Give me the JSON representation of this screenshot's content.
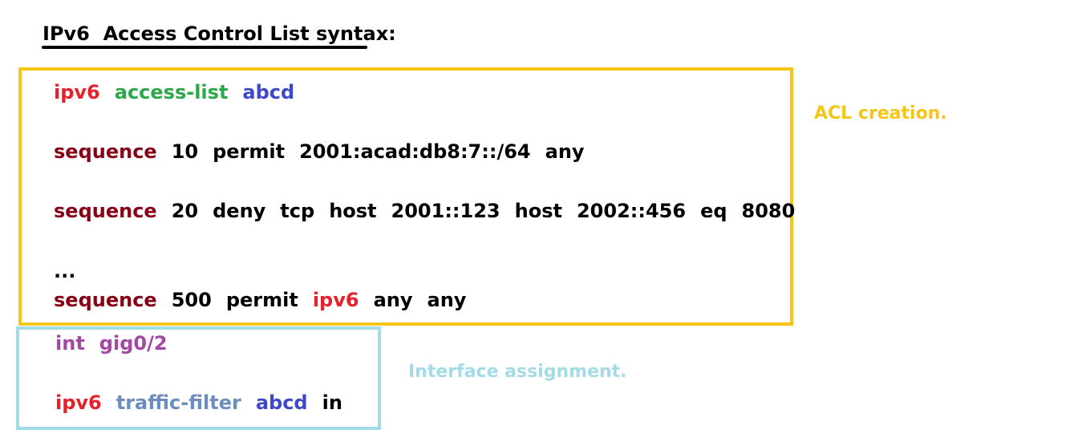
{
  "title": "IPv6  Access Control List syntax:",
  "acl_section": {
    "label": "ACL creation.",
    "lines": [
      [
        {
          "text": "ipv6",
          "color": "red"
        },
        {
          "text": "access-list",
          "color": "green"
        },
        {
          "text": "abcd",
          "color": "blue"
        }
      ],
      [
        {
          "text": "sequence",
          "color": "maroon"
        },
        {
          "text": "10",
          "color": "black"
        },
        {
          "text": "permit",
          "color": "black"
        },
        {
          "text": "2001:acad:db8:7::/64",
          "color": "black"
        },
        {
          "text": "any",
          "color": "black"
        }
      ],
      [
        {
          "text": "sequence",
          "color": "maroon"
        },
        {
          "text": "20",
          "color": "black"
        },
        {
          "text": "deny",
          "color": "black"
        },
        {
          "text": "tcp",
          "color": "black"
        },
        {
          "text": "host",
          "color": "black"
        },
        {
          "text": "2001::123",
          "color": "black"
        },
        {
          "text": "host",
          "color": "black"
        },
        {
          "text": "2002::456",
          "color": "black"
        },
        {
          "text": "eq",
          "color": "black"
        },
        {
          "text": "8080",
          "color": "black"
        }
      ],
      [
        {
          "text": "...",
          "color": "black"
        }
      ],
      [
        {
          "text": "sequence",
          "color": "maroon"
        },
        {
          "text": "500",
          "color": "black"
        },
        {
          "text": "permit",
          "color": "black"
        },
        {
          "text": "ipv6",
          "color": "red"
        },
        {
          "text": "any",
          "color": "black"
        },
        {
          "text": "any",
          "color": "black"
        }
      ]
    ]
  },
  "interface_section": {
    "label": "Interface assignment.",
    "lines": [
      [
        {
          "text": "int",
          "color": "purple"
        },
        {
          "text": "gig0/2",
          "color": "purple"
        }
      ],
      [
        {
          "text": "ipv6",
          "color": "red"
        },
        {
          "text": "traffic-filter",
          "color": "steel"
        },
        {
          "text": "abcd",
          "color": "blue"
        },
        {
          "text": "in",
          "color": "black"
        }
      ]
    ]
  },
  "colors": {
    "red": "#e8202a",
    "green": "#2aa84a",
    "blue": "#3f48cc",
    "maroon": "#880015",
    "purple": "#a349a4",
    "steel": "#6b8ebf",
    "black": "#000000",
    "acl_border": "#f5c518",
    "interface_border": "#a3dce6"
  }
}
